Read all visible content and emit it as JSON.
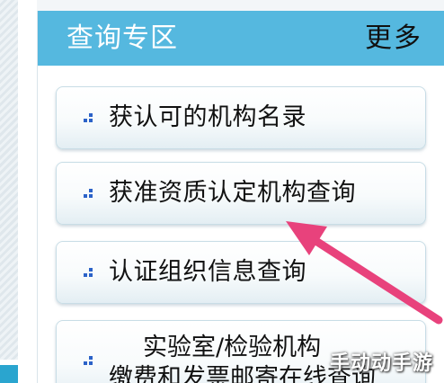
{
  "panel": {
    "title": "查询专区",
    "more_label": "更多"
  },
  "menu": {
    "items": [
      {
        "label": "获认可的机构名录"
      },
      {
        "label": "获准资质认定机构查询"
      },
      {
        "label": "认证组织信息查询"
      },
      {
        "label_line1": "实验室/检验机构",
        "label_line2": "缴费和发票邮寄在线查询"
      }
    ]
  },
  "watermark": {
    "text": "手动动手游"
  },
  "colors": {
    "header_bg": "#55b8df",
    "header_text": "#ffffff",
    "bullet": "#2b62c8",
    "arrow": "#e8427c"
  },
  "icons": {
    "bullet": "small-blue-squares-icon",
    "arrow": "pink-arrow-annotation"
  }
}
